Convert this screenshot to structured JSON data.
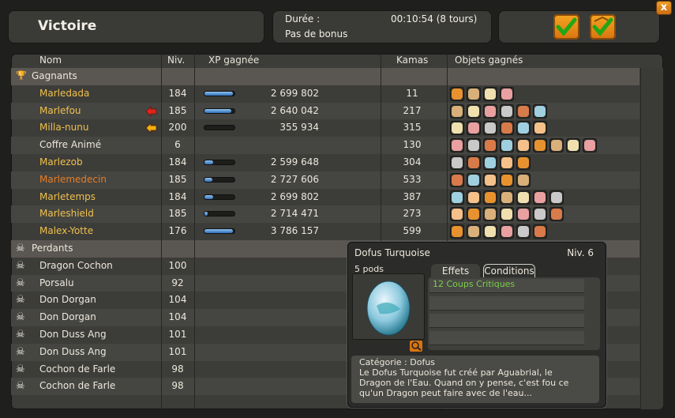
{
  "window": {
    "title": "Victoire",
    "duration_label": "Durée :",
    "duration_value": "00:10:54 (8 tours)",
    "bonus": "Pas de bonus",
    "close_label": "x"
  },
  "columns": {
    "name": "Nom",
    "level": "Niv.",
    "xp": "XP gagnée",
    "kamas": "Kamas",
    "items": "Objets gagnés"
  },
  "winners_label": "Gagnants",
  "losers_label": "Perdants",
  "winners": [
    {
      "name": "Marledada",
      "level": "184",
      "xp": "2 699 802",
      "xp_fill": 0.95,
      "kamas": "11",
      "items": 4
    },
    {
      "name": "Marlefou",
      "level": "185",
      "xp": "2 640 042",
      "xp_fill": 0.9,
      "kamas": "217",
      "items": 6
    },
    {
      "name": "Milla-nunu",
      "level": "200",
      "xp": "355 934",
      "xp_fill": 0.0,
      "kamas": "315",
      "items": 6
    },
    {
      "name": "Coffre Animé",
      "level": "6",
      "xp": "",
      "xp_fill": null,
      "kamas": "130",
      "items": 9
    },
    {
      "name": "Marlezob",
      "level": "184",
      "xp": "2 599 648",
      "xp_fill": 0.3,
      "kamas": "304",
      "items": 5
    },
    {
      "name": "Marlemedecin",
      "level": "185",
      "xp": "2 727 606",
      "xp_fill": 0.25,
      "kamas": "533",
      "items": 5
    },
    {
      "name": "Marletemps",
      "level": "184",
      "xp": "2 699 802",
      "xp_fill": 0.3,
      "kamas": "387",
      "items": 7
    },
    {
      "name": "Marleshield",
      "level": "185",
      "xp": "2 714 471",
      "xp_fill": 0.1,
      "kamas": "273",
      "items": 7
    },
    {
      "name": "Malex-Yotte",
      "level": "176",
      "xp": "3 786 157",
      "xp_fill": 0.95,
      "kamas": "599",
      "items": 6
    }
  ],
  "losers": [
    {
      "name": "Dragon Cochon",
      "level": "100"
    },
    {
      "name": "Porsalu",
      "level": "92"
    },
    {
      "name": "Don Dorgan",
      "level": "104"
    },
    {
      "name": "Don Dorgan",
      "level": "104"
    },
    {
      "name": "Don Duss Ang",
      "level": "101"
    },
    {
      "name": "Don Duss Ang",
      "level": "101"
    },
    {
      "name": "Cochon de Farle",
      "level": "98"
    },
    {
      "name": "Cochon de Farle",
      "level": "98"
    }
  ],
  "tooltip": {
    "name": "Dofus Turquoise",
    "level": "Niv. 6",
    "pods": "5 pods",
    "tab_effects": "Effets",
    "tab_conditions": "Conditions",
    "effect": "12 Coups Critiques",
    "category": "Catégorie : Dofus",
    "desc_1": "Le Dofus Turquoise fut créé par Aguabrial, le",
    "desc_2": "Dragon de l'Eau. Quand on y pense, c'est fou ce",
    "desc_3": "qu'un Dragon peut faire avec de l'eau..."
  },
  "colors": {
    "accent": "#f0c14b",
    "orange": "#e67e22",
    "xp_bar": "#2f6fb8",
    "effect_green": "#7bd04b"
  }
}
